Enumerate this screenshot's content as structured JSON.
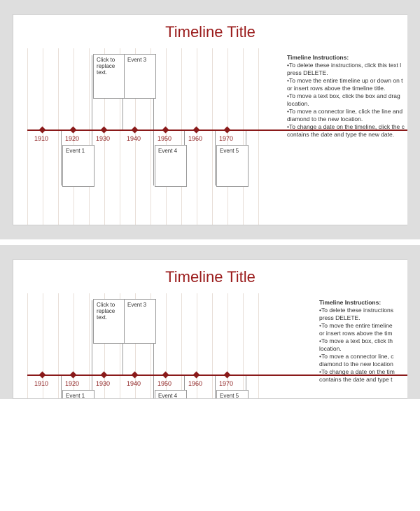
{
  "title": "Timeline Title",
  "periods": [
    "1910",
    "1920",
    "1930",
    "1940",
    "1950",
    "1960",
    "1970"
  ],
  "events": {
    "placeholder": "Click to replace text.",
    "e1": "Event 1",
    "e3": "Event 3",
    "e4": "Event 4",
    "e5": "Event 5"
  },
  "instructions": {
    "heading": "Timeline Instructions:",
    "full": [
      "To delete these instructions, click this text box and press DELETE.",
      "To move the entire timeline up or down on the page, or insert rows above the timeline title.",
      "To move a text box, click the box and drag it to the new location.",
      "To move a connector line, click the line and drag the diamond to the new location.",
      "To change a date on the timeline, click the cell that contains the date and type the new date."
    ],
    "clipped": [
      "To delete these instructions, click this text l",
      "press DELETE.",
      "To move the entire timeline up or down on t",
      "or insert rows above the timeline title.",
      "To move a text box, click the box and drag",
      "location.",
      "To move a connector line, click the line and",
      "diamond to the new location.",
      "To change a date on the timeline, click the c",
      "contains the date and type the new date."
    ],
    "clipped2": [
      "To delete these instructions",
      "press DELETE.",
      "To move the entire timeline",
      "or insert rows above the tim",
      "To move a text box, click th",
      "location.",
      "To move a connector line, c",
      "diamond to the new location",
      "To change a date on the tim",
      "contains the date and type t"
    ]
  },
  "chart_data": {
    "type": "timeline",
    "axis_values": [
      1910,
      1920,
      1930,
      1940,
      1950,
      1960,
      1970
    ],
    "events": [
      {
        "label": "Event 1",
        "year": 1920,
        "position": "below"
      },
      {
        "label": "Click to replace text.",
        "year": 1925,
        "position": "above"
      },
      {
        "label": "Event 3",
        "year": 1935,
        "position": "above"
      },
      {
        "label": "Event 4",
        "year": 1950,
        "position": "below"
      },
      {
        "label": "Event 5",
        "year": 1970,
        "position": "below"
      }
    ],
    "title": "Timeline Title"
  }
}
